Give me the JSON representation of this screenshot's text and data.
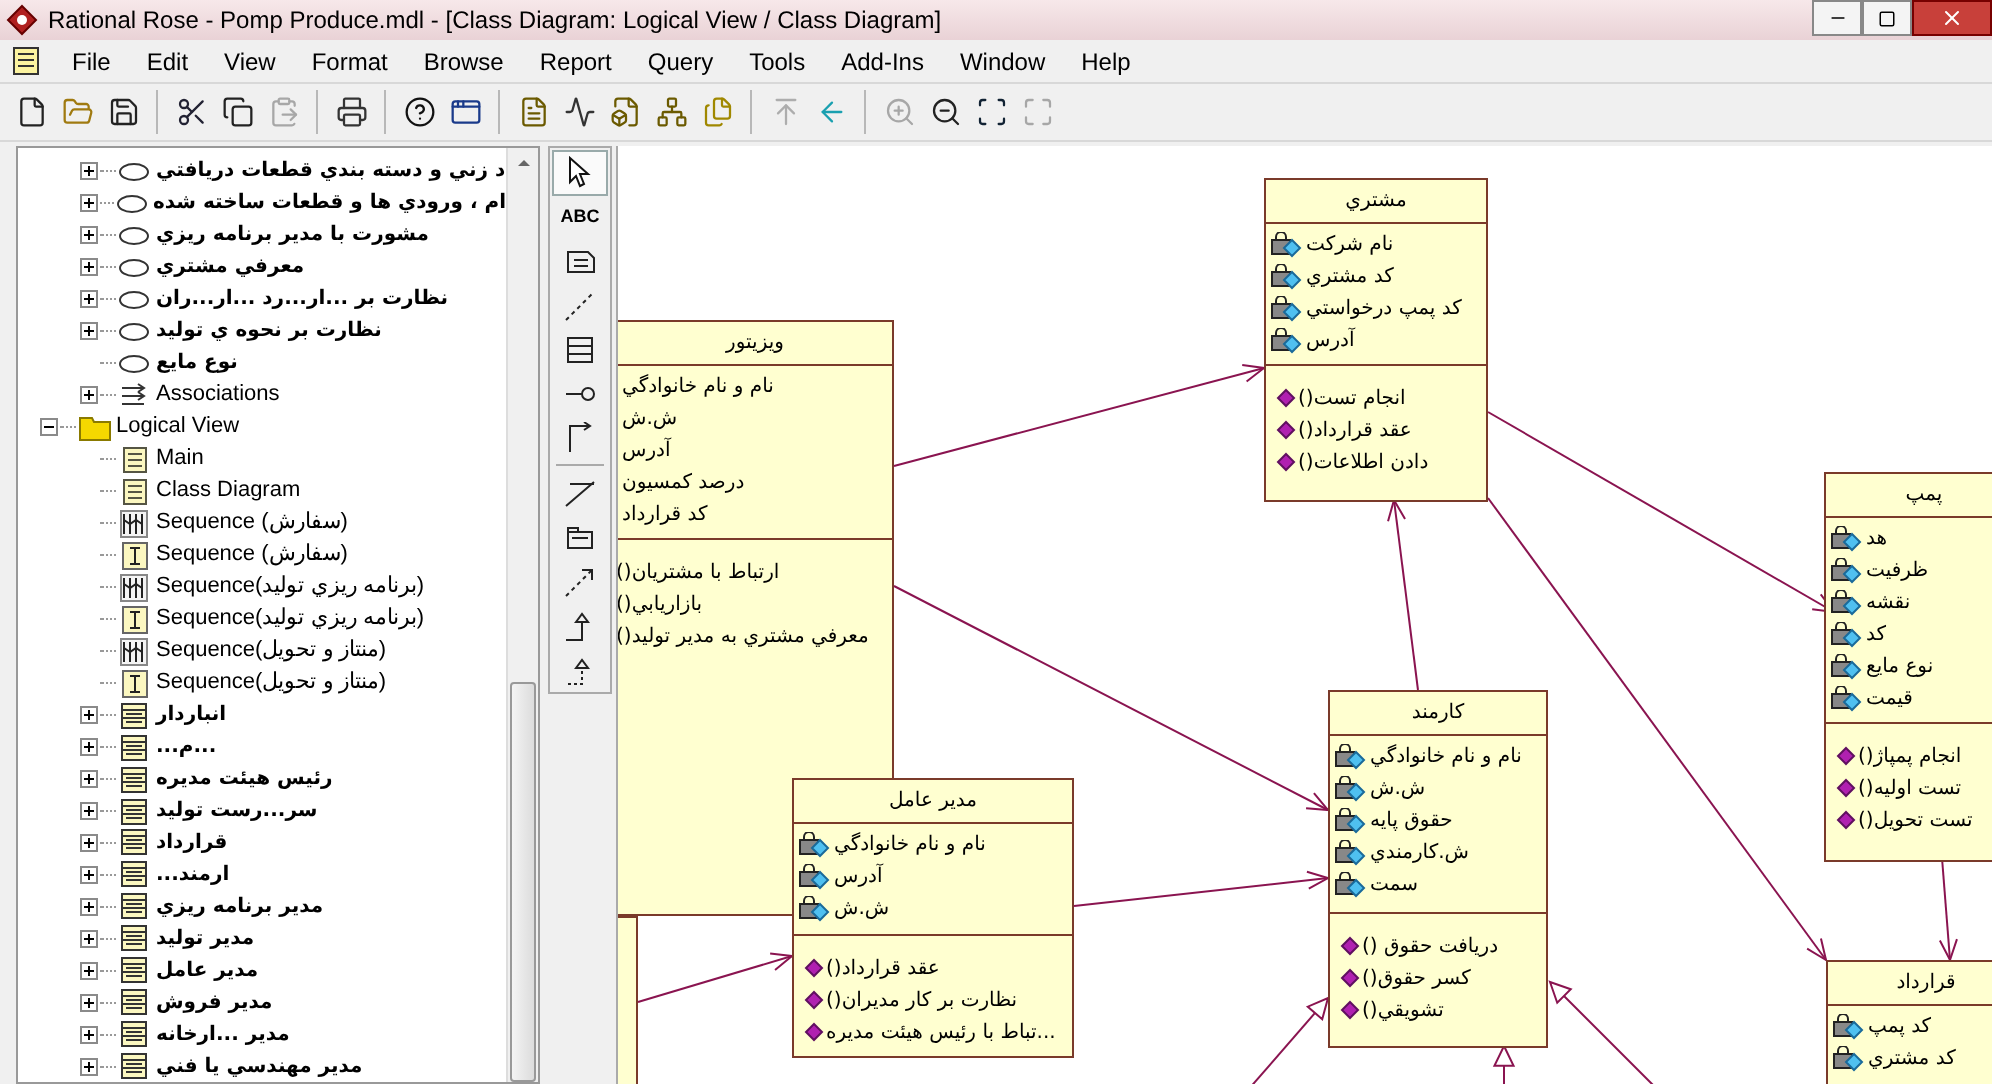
{
  "window": {
    "title": "Rational Rose - Pomp Produce.mdl - [Class Diagram: Logical View / Class Diagram]"
  },
  "menu": {
    "file": "File",
    "edit": "Edit",
    "view": "View",
    "format": "Format",
    "browse": "Browse",
    "report": "Report",
    "query": "Query",
    "tools": "Tools",
    "add_ins": "Add-Ins",
    "window": "Window",
    "help": "Help"
  },
  "toolbar": [
    {
      "kind": "new",
      "disabled": false
    },
    {
      "kind": "open",
      "disabled": false
    },
    {
      "kind": "save",
      "disabled": false
    },
    {
      "kind": "separator"
    },
    {
      "kind": "cut",
      "disabled": false
    },
    {
      "kind": "copy",
      "disabled": false
    },
    {
      "kind": "paste",
      "disabled": true
    },
    {
      "kind": "separator"
    },
    {
      "kind": "print",
      "disabled": false
    },
    {
      "kind": "separator"
    },
    {
      "kind": "help",
      "disabled": false
    },
    {
      "kind": "window",
      "disabled": false
    },
    {
      "kind": "separator"
    },
    {
      "kind": "class_diagram",
      "disabled": false
    },
    {
      "kind": "sequence",
      "disabled": false
    },
    {
      "kind": "component",
      "disabled": false
    },
    {
      "kind": "deployment",
      "disabled": false
    },
    {
      "kind": "documents",
      "disabled": false
    },
    {
      "kind": "separator"
    },
    {
      "kind": "parent",
      "disabled": true
    },
    {
      "kind": "back",
      "disabled": false
    },
    {
      "kind": "separator"
    },
    {
      "kind": "zoom_in",
      "disabled": true
    },
    {
      "kind": "zoom_out",
      "disabled": false
    },
    {
      "kind": "fit",
      "disabled": false
    },
    {
      "kind": "fit_selection",
      "disabled": true
    }
  ],
  "browser": {
    "scrolled_branch_items": [
      {
        "kind": "use_case",
        "label": "د زني و دسته بندي قطعات دريافتي",
        "expanded": false
      },
      {
        "kind": "use_case",
        "label": "ام ، ورودي ها و قطعات ساخته شده",
        "expanded": false
      },
      {
        "kind": "use_case",
        "label": "مشورت با مدير برنامه ريزي",
        "expanded": false
      },
      {
        "kind": "use_case",
        "label": "معرفي مشتري",
        "expanded": false
      },
      {
        "kind": "use_case",
        "label": "نظارت بر ...ار...رد ...ار...ران",
        "expanded": false
      },
      {
        "kind": "use_case",
        "label": "نظارت بر نحوه ي توليد",
        "expanded": false
      },
      {
        "kind": "use_case",
        "label": "نوع مايع"
      },
      {
        "kind": "associations",
        "label": "Associations",
        "expanded": false
      }
    ],
    "nodes": [
      {
        "kind": "folder",
        "label": "Logical View",
        "expanded": true,
        "children": [
          {
            "kind": "class_diagram",
            "label": "Main"
          },
          {
            "kind": "class_diagram",
            "label": "Class Diagram"
          },
          {
            "kind": "sequence",
            "label": "Sequence (سفارش)"
          },
          {
            "kind": "collaboration",
            "label": "Sequence (سفارش)"
          },
          {
            "kind": "sequence",
            "label": "Sequence(برنامه ريزي توليد)"
          },
          {
            "kind": "collaboration",
            "label": "Sequence(برنامه ريزي توليد)"
          },
          {
            "kind": "sequence",
            "label": "Sequence(منتاز و تحويل)"
          },
          {
            "kind": "collaboration",
            "label": "Sequence(منتاز و تحويل)"
          },
          {
            "kind": "class",
            "label": "انباردار",
            "expanded": false
          },
          {
            "kind": "class",
            "label": "...م...",
            "expanded": false
          },
          {
            "kind": "class",
            "label": "رئيس  هيئت مديره",
            "expanded": false
          },
          {
            "kind": "class",
            "label": "سر...رست  توليد",
            "expanded": false
          },
          {
            "kind": "class",
            "label": "قرارداد",
            "expanded": false
          },
          {
            "kind": "class",
            "label": "...ارمند",
            "expanded": false
          },
          {
            "kind": "class",
            "label": "مدير برنامه ريزي",
            "expanded": false
          },
          {
            "kind": "class",
            "label": "مدير توليد",
            "expanded": false
          },
          {
            "kind": "class",
            "label": "مدير عامل",
            "expanded": false
          },
          {
            "kind": "class",
            "label": "مدير فروش",
            "expanded": false
          },
          {
            "kind": "class",
            "label": "مدير ...ارخانه",
            "expanded": false
          },
          {
            "kind": "class",
            "label": "مدير مهندسي يا فني",
            "expanded": false
          }
        ]
      }
    ]
  },
  "diagram_tools": [
    {
      "kind": "select",
      "selected": true
    },
    {
      "kind": "text",
      "label": "ABC",
      "selected": false
    },
    {
      "kind": "note",
      "selected": false
    },
    {
      "kind": "anchor",
      "selected": false
    },
    {
      "kind": "class",
      "selected": false
    },
    {
      "kind": "interface",
      "selected": false
    },
    {
      "kind": "association",
      "selected": false
    },
    {
      "kind": "separator"
    },
    {
      "kind": "association_class",
      "selected": false
    },
    {
      "kind": "package",
      "selected": false
    },
    {
      "kind": "dependency",
      "selected": false
    },
    {
      "kind": "generalization",
      "selected": false
    },
    {
      "kind": "realization",
      "selected": false
    }
  ],
  "classes": [
    {
      "name": "مشتري",
      "attributes": [
        "نام شركت",
        "كد مشتري",
        "كد پمپ درخواستي",
        "آدرس"
      ],
      "operations": [
        "()انجام تست",
        "()عقد قرارداد",
        "()دادن اطلاعات"
      ],
      "cut_left": false
    },
    {
      "name": "ويزيتور",
      "attributes": [
        "نام و نام خانوادگي",
        "ش.ش",
        "آدرس",
        "درصد كمسيون",
        "كد قرارداد"
      ],
      "operations": [
        "()ارتباط با مشتريان",
        "()بازاريابي",
        "()معرفي مشتري به مدير توليد"
      ],
      "cut_left": true
    },
    {
      "name": "پمپ",
      "attributes": [
        "هد",
        "ظرفيت",
        "نقشه",
        "كد",
        "نوع مايع",
        "قيمت"
      ],
      "operations": [
        "()انجام پمپاژ",
        "()تست اوليه",
        "()تست تحويل"
      ],
      "cut_left": false
    },
    {
      "name": "كارمند",
      "attributes": [
        "نام و نام خانوادگي",
        "ش.ش",
        "حقوق پايه",
        "ش.كارمندي",
        "سمت"
      ],
      "operations": [
        "() دريافت حقوق",
        "()كسر حقوق",
        "()تشويقي"
      ],
      "cut_left": false
    },
    {
      "name": "مدير عامل",
      "attributes": [
        "نام و نام خانوادگي",
        "آدرس",
        "ش.ش"
      ],
      "operations": [
        "()عقد قرارداد",
        "()نظارت بر كار مديران",
        "تباط با رئيس هيئت مديره..."
      ],
      "cut_left": false
    },
    {
      "name": "قرارداد",
      "attributes": [
        "كد پمپ",
        "كد مشتري"
      ],
      "cut_left": false
    }
  ]
}
